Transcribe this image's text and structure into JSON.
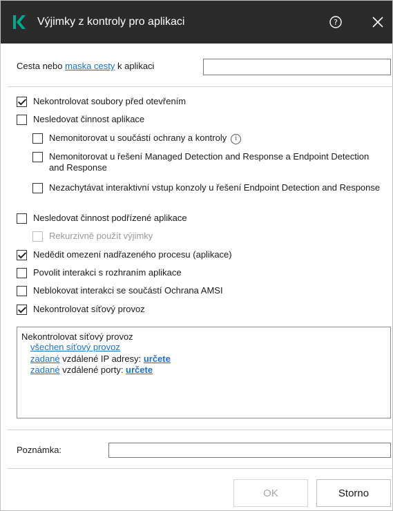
{
  "window": {
    "title": "Výjimky z kontroly pro aplikaci",
    "logo_letter": "K",
    "accent_color": "#00a88e"
  },
  "path": {
    "label_prefix": "Cesta nebo ",
    "label_link": "maska cesty",
    "label_suffix": " k aplikaci",
    "value": ""
  },
  "options": [
    {
      "label": "Nekontrolovat soubory před otevřením",
      "checked": true
    },
    {
      "label": "Nesledovat činnost aplikace",
      "checked": false
    },
    {
      "label": "Nemonitorovat u součástí ochrany a kontroly",
      "checked": false
    },
    {
      "label": "Nemonitorovat u řešení Managed Detection and Response a Endpoint Detection and Response",
      "checked": false
    },
    {
      "label": "Nezachytávat interaktivní vstup konzoly u řešení Endpoint Detection and Response",
      "checked": false
    },
    {
      "label": "Nesledovat činnost podřízené aplikace",
      "checked": false
    },
    {
      "label": "Rekurzivně použít výjimky",
      "checked": false,
      "disabled": true
    },
    {
      "label": "Nedědit omezení nadřazeného procesu (aplikace)",
      "checked": true
    },
    {
      "label": "Povolit interakci s rozhraním aplikace",
      "checked": false
    },
    {
      "label": "Neblokovat interakci se součástí Ochrana AMSI",
      "checked": false
    },
    {
      "label": "Nekontrolovat síťový provoz",
      "checked": true
    }
  ],
  "network": {
    "heading": "Nekontrolovat síťový provoz",
    "all_traffic_link": "všechen síťový provoz",
    "ip_link": "zadané",
    "ip_text": " vzdálené IP adresy: ",
    "ip_value_link": "určete",
    "ports_link": "zadané",
    "ports_text": " vzdálené porty: ",
    "ports_value_link": "určete"
  },
  "note": {
    "label": "Poznámka:",
    "value": ""
  },
  "buttons": {
    "ok": "OK",
    "cancel": "Storno"
  }
}
